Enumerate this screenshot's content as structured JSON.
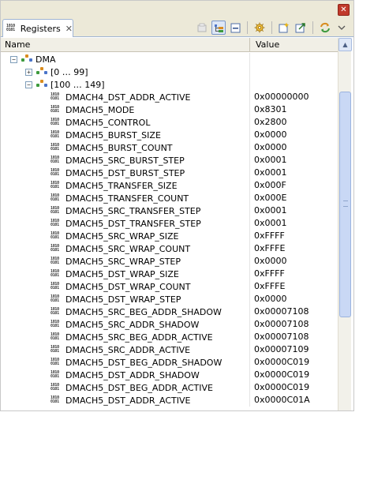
{
  "view": {
    "tab_label": "Registers",
    "tab_close": "✕",
    "close_glyph": "✕"
  },
  "columns": {
    "name": "Name",
    "value": "Value"
  },
  "tree": {
    "root": {
      "label": "DMA",
      "expander": "−"
    },
    "groups": [
      {
        "label": "[0 … 99]",
        "expander": "+"
      },
      {
        "label": "[100 … 149]",
        "expander": "−"
      }
    ]
  },
  "registers": [
    {
      "name": "DMACH4_DST_ADDR_ACTIVE",
      "value": "0x00000000"
    },
    {
      "name": "DMACH5_MODE",
      "value": "0x8301"
    },
    {
      "name": "DMACH5_CONTROL",
      "value": "0x2800"
    },
    {
      "name": "DMACH5_BURST_SIZE",
      "value": "0x0000"
    },
    {
      "name": "DMACH5_BURST_COUNT",
      "value": "0x0000"
    },
    {
      "name": "DMACH5_SRC_BURST_STEP",
      "value": "0x0001"
    },
    {
      "name": "DMACH5_DST_BURST_STEP",
      "value": "0x0001"
    },
    {
      "name": "DMACH5_TRANSFER_SIZE",
      "value": "0x000F"
    },
    {
      "name": "DMACH5_TRANSFER_COUNT",
      "value": "0x000E"
    },
    {
      "name": "DMACH5_SRC_TRANSFER_STEP",
      "value": "0x0001"
    },
    {
      "name": "DMACH5_DST_TRANSFER_STEP",
      "value": "0x0001"
    },
    {
      "name": "DMACH5_SRC_WRAP_SIZE",
      "value": "0xFFFF"
    },
    {
      "name": "DMACH5_SRC_WRAP_COUNT",
      "value": "0xFFFE"
    },
    {
      "name": "DMACH5_SRC_WRAP_STEP",
      "value": "0x0000"
    },
    {
      "name": "DMACH5_DST_WRAP_SIZE",
      "value": "0xFFFF"
    },
    {
      "name": "DMACH5_DST_WRAP_COUNT",
      "value": "0xFFFE"
    },
    {
      "name": "DMACH5_DST_WRAP_STEP",
      "value": "0x0000"
    },
    {
      "name": "DMACH5_SRC_BEG_ADDR_SHADOW",
      "value": "0x00007108"
    },
    {
      "name": "DMACH5_SRC_ADDR_SHADOW",
      "value": "0x00007108"
    },
    {
      "name": "DMACH5_SRC_BEG_ADDR_ACTIVE",
      "value": "0x00007108"
    },
    {
      "name": "DMACH5_SRC_ADDR_ACTIVE",
      "value": "0x00007109"
    },
    {
      "name": "DMACH5_DST_BEG_ADDR_SHADOW",
      "value": "0x0000C019"
    },
    {
      "name": "DMACH5_DST_ADDR_SHADOW",
      "value": "0x0000C019"
    },
    {
      "name": "DMACH5_DST_BEG_ADDR_ACTIVE",
      "value": "0x0000C019"
    },
    {
      "name": "DMACH5_DST_ADDR_ACTIVE",
      "value": "0x0000C01A"
    }
  ],
  "icons": {
    "binary_glyph": "1010\n0101",
    "toolbar": [
      "disabled-icon",
      "tree-layout-icon",
      "collapse-all-icon",
      "gear-icon",
      "new-group-icon",
      "export-icon",
      "sync-icon",
      "view-menu-chevron-icon"
    ]
  },
  "colors": {
    "close_button": "#c0392b",
    "tab_border": "#9fb4d3",
    "scroll_thumb": "#c9d8f5"
  }
}
